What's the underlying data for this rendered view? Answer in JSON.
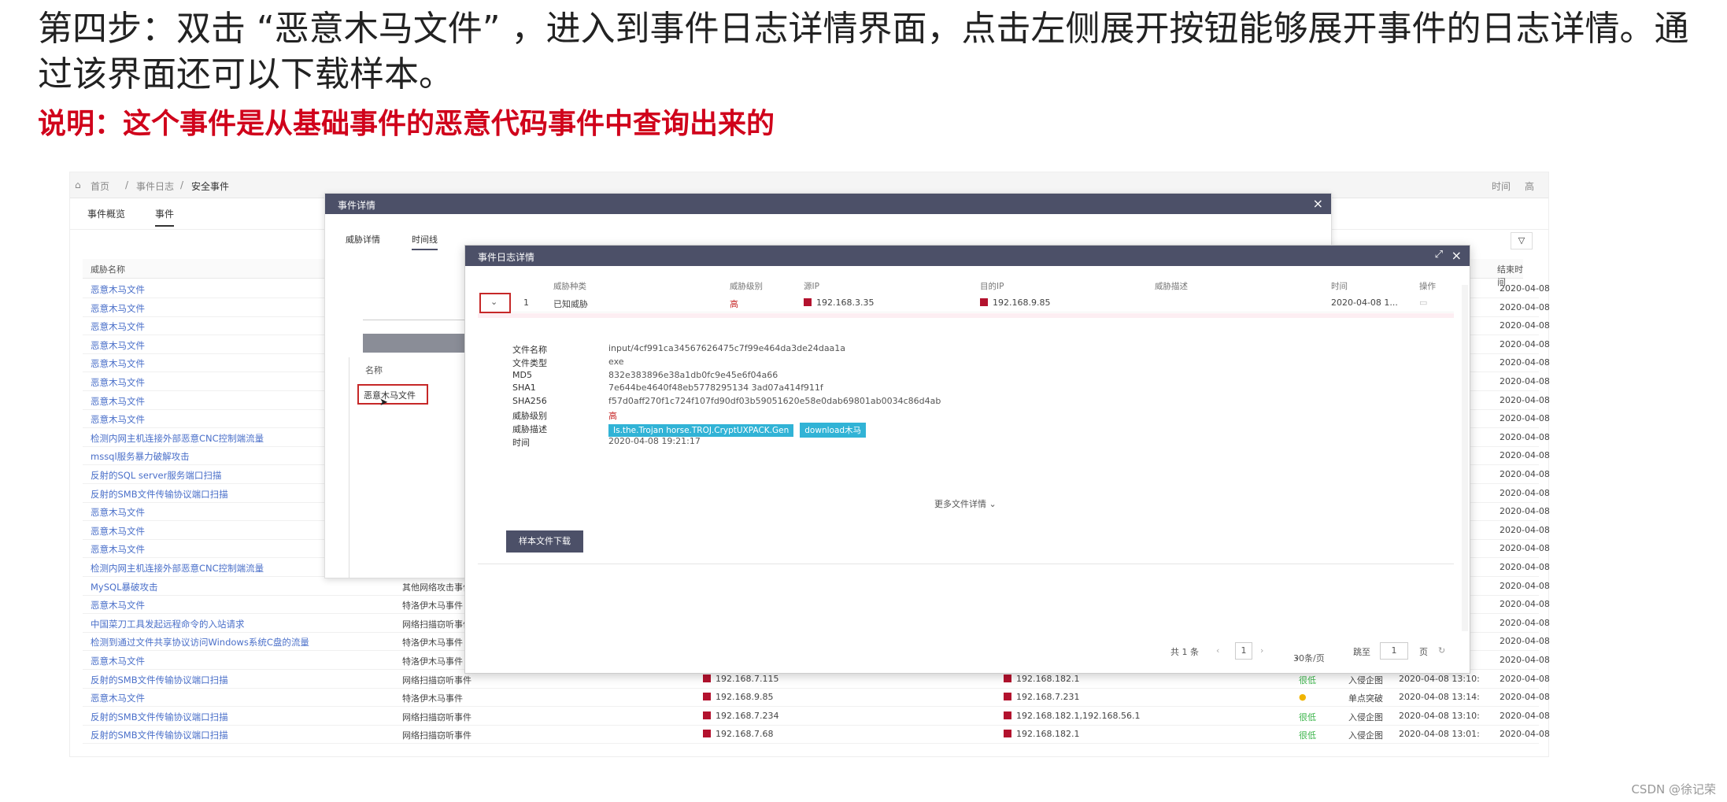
{
  "slide": {
    "step_text": "第四步：双击 “恶意木马文件” ，进入到事件日志详情界面，点击左侧展开按钮能够展开事件的日志详情。通过该界面还可以下载样本。",
    "note_text": "说明：这个事件是从基础事件的恶意代码事件中查询出来的",
    "watermark": "CSDN @徐记荣"
  },
  "colors": {
    "header": "#4c5068",
    "highlight": "#c62828",
    "link": "#4a6fc9",
    "tag": "#31b3d6",
    "danger": "#b3122e"
  },
  "app": {
    "breadcrumb": [
      "首页",
      "事件日志",
      "安全事件"
    ],
    "breadcrumb_right": [
      "时间",
      "高"
    ],
    "tabs": [
      "事件概览",
      "事件"
    ],
    "left_header": "威胁名称",
    "right_header": "结束时间",
    "rows": [
      {
        "name": "恶意木马文件",
        "time2": "2020-04-08"
      },
      {
        "name": "恶意木马文件",
        "time2": "2020-04-08"
      },
      {
        "name": "恶意木马文件",
        "time2": "2020-04-08"
      },
      {
        "name": "恶意木马文件",
        "time2": "2020-04-08"
      },
      {
        "name": "恶意木马文件",
        "time2": "2020-04-08"
      },
      {
        "name": "恶意木马文件",
        "time2": "2020-04-08"
      },
      {
        "name": "恶意木马文件",
        "time2": "2020-04-08"
      },
      {
        "name": "恶意木马文件",
        "time2": "2020-04-08"
      },
      {
        "name": "检测内网主机连接外部恶意CNC控制端流量",
        "time2": "2020-04-08"
      },
      {
        "name": "mssql服务暴力破解攻击",
        "time2": "2020-04-08"
      },
      {
        "name": "反射的SQL server服务端口扫描",
        "time2": "2020-04-08"
      },
      {
        "name": "反射的SMB文件传输协议端口扫描",
        "time2": "2020-04-08"
      },
      {
        "name": "恶意木马文件",
        "time2": "2020-04-08"
      },
      {
        "name": "恶意木马文件",
        "time2": "2020-04-08"
      },
      {
        "name": "恶意木马文件",
        "time2": "2020-04-08"
      },
      {
        "name": "检测内网主机连接外部恶意CNC控制端流量",
        "time2": "2020-04-08"
      },
      {
        "name": "MySQL暴破攻击",
        "type": "其他网络攻击事件",
        "time2": "2020-04-08"
      },
      {
        "name": "恶意木马文件",
        "type": "特洛伊木马事件",
        "time2": "2020-04-08"
      },
      {
        "name": "中国菜刀工具发起远程命令的入站请求",
        "type": "网络扫描窃听事件",
        "time2": "2020-04-08"
      },
      {
        "name": "检测到通过文件共享协议访问Windows系统C盘的流量",
        "type": "特洛伊木马事件",
        "time2": "2020-04-08"
      },
      {
        "name": "恶意木马文件",
        "type": "特洛伊木马事件",
        "time2": "2020-04-08"
      },
      {
        "name": "反射的SMB文件传输协议端口扫描",
        "type": "网络扫描窃听事件",
        "sip": "192.168.7.115",
        "dip": "192.168.182.1",
        "lvl": "很低",
        "stage": "入侵企图",
        "time": "2020-04-08 13:10:",
        "time2": "2020-04-08"
      },
      {
        "name": "恶意木马文件",
        "type": "特洛伊木马事件",
        "sip": "192.168.9.85",
        "dip": "192.168.7.231",
        "lvl": "●",
        "stage": "单点突破",
        "time": "2020-04-08 13:14:",
        "time2": "2020-04-08"
      },
      {
        "name": "反射的SMB文件传输协议端口扫描",
        "type": "网络扫描窃听事件",
        "sip": "192.168.7.234",
        "dip": "192.168.182.1,192.168.56.1",
        "lvl": "很低",
        "stage": "入侵企图",
        "time": "2020-04-08 13:10:",
        "time2": "2020-04-08"
      },
      {
        "name": "反射的SMB文件传输协议端口扫描",
        "type": "网络扫描窃听事件",
        "sip": "192.168.7.68",
        "dip": "192.168.182.1",
        "lvl": "很低",
        "stage": "入侵企图",
        "time": "2020-04-08 13:01:",
        "time2": "2020-04-08"
      }
    ]
  },
  "modal1": {
    "title": "事件详情",
    "tabs": [
      "威胁详情",
      "时间线"
    ],
    "name_label": "名称",
    "name_item": "恶意木马文件"
  },
  "modal2": {
    "title": "事件日志详情",
    "columns": [
      "威胁种类",
      "威胁级别",
      "源IP",
      "目的IP",
      "威胁描述",
      "时间",
      "操作"
    ],
    "row": {
      "index": "1",
      "kind": "已知威胁",
      "level": "高",
      "src_ip": "192.168.3.35",
      "dst_ip": "192.168.9.85",
      "time": "2020-04-08 1..."
    },
    "details": [
      {
        "k": "文件名称",
        "v": "input/4cf991ca34567626475c7f99e464da3de24daa1a"
      },
      {
        "k": "文件类型",
        "v": "exe"
      },
      {
        "k": "MD5",
        "v": "832e383896e38a1db0fc9e45e6f04a66"
      },
      {
        "k": "SHA1",
        "v": "7e644be4640f48eb5778295134 3ad07a414f911f"
      },
      {
        "k": "SHA256",
        "v": "f57d0aff270f1c724f107fd90df03b59051620e58e0dab69801ab0034c86d4ab"
      },
      {
        "k": "威胁级别",
        "v": "高"
      },
      {
        "k": "威胁描述",
        "tags": [
          "Is.the.Trojan horse.TROJ.CryptUXPACK.Gen",
          "download木马"
        ]
      },
      {
        "k": "时间",
        "v": "2020-04-08 19:21:17"
      }
    ],
    "more_label": "更多文件详情",
    "download_label": "样本文件下载",
    "pager": {
      "total": "共 1 条",
      "current": "1",
      "per_page": "30条/页",
      "goto_label": "跳至",
      "goto_value": "1",
      "page_unit": "页"
    }
  }
}
